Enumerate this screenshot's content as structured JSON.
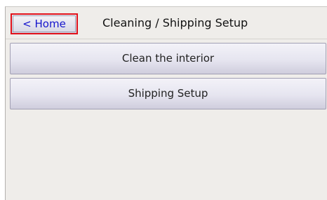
{
  "header": {
    "home_label": "< Home",
    "title": "Cleaning /  Shipping Setup"
  },
  "menu": {
    "items": [
      {
        "label": "Clean the interior"
      },
      {
        "label": "Shipping Setup"
      }
    ]
  }
}
